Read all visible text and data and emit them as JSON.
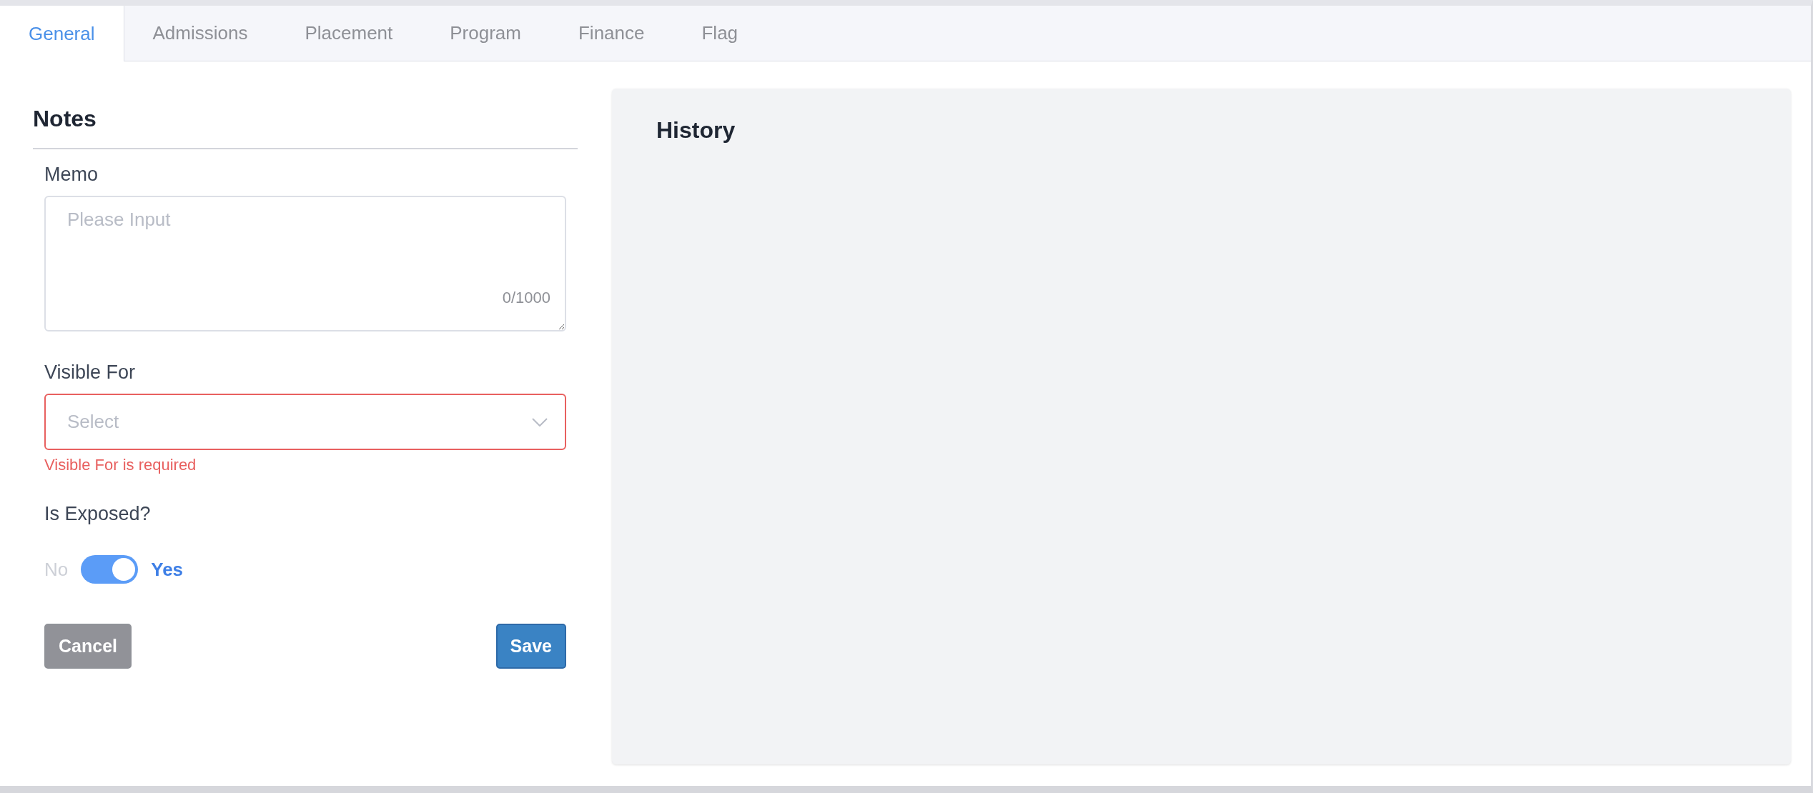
{
  "tabs": [
    {
      "label": "General",
      "selected": true
    },
    {
      "label": "Admissions",
      "selected": false
    },
    {
      "label": "Placement",
      "selected": false
    },
    {
      "label": "Program",
      "selected": false
    },
    {
      "label": "Finance",
      "selected": false
    },
    {
      "label": "Flag",
      "selected": false
    }
  ],
  "notes": {
    "title": "Notes",
    "memo": {
      "label": "Memo",
      "placeholder": "Please Input",
      "counter": "0/1000"
    },
    "visible_for": {
      "label": "Visible For",
      "placeholder": "Select",
      "error": "Visible For is required"
    },
    "is_exposed": {
      "label": "Is Exposed?",
      "off_label": "No",
      "on_label": "Yes",
      "on": true
    },
    "buttons": [
      {
        "label": "Cancel",
        "kind": "secondary"
      },
      {
        "label": "Save",
        "kind": "primary"
      }
    ]
  },
  "history": {
    "title": "History"
  }
}
